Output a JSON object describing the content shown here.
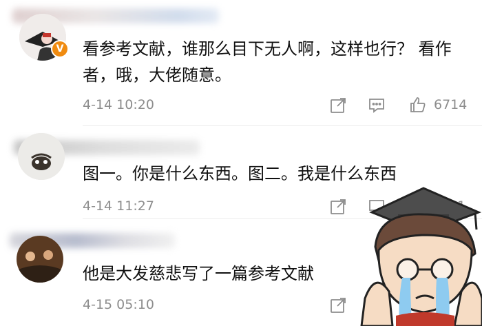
{
  "comments": [
    {
      "text": "看参考文献，谁那么目下无人啊，这样也行？ 看作者，哦，大佬随意。",
      "time": "4-14 10:20",
      "likes": "6714",
      "badge": "V"
    },
    {
      "text": "图一。你是什么东西。图二。我是什么东西",
      "time": "4-14 11:27",
      "likes": "421"
    },
    {
      "text": "他是大发慈悲写了一篇参考文献",
      "time": "4-15 05:10"
    }
  ],
  "icons": [
    "share-icon",
    "comment-icon",
    "like-icon"
  ],
  "colors": {
    "badge": "#f08b10",
    "meta": "#8d8d8d",
    "text": "#111111"
  }
}
